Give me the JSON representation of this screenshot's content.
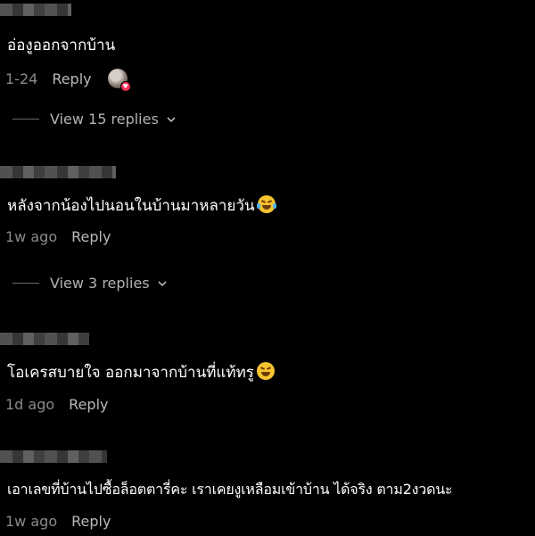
{
  "comments": [
    {
      "text": "อ่องูออกจากบ้าน",
      "emoji": "",
      "time": "1-24",
      "reply_label": "Reply",
      "view_replies": "View 15 replies"
    },
    {
      "text": "หลังจากน้องไปนอนในบ้านมาหลายวัน",
      "emoji": "tears-of-joy-emoji",
      "time": "1w ago",
      "reply_label": "Reply",
      "view_replies": "View 3 replies"
    },
    {
      "text": "โอเครสบายใจ ออกมาจากบ้านที่แท้ทรู",
      "emoji": "laughing-emoji",
      "time": "1d ago",
      "reply_label": "Reply"
    },
    {
      "text": "เอาเลขที่บ้านไปซื้อล็อตตารี่คะ เราเคยงูเหลือมเข้าบ้าน ได้จริง ตาม2งวดนะ",
      "emoji": "",
      "time": "1w ago",
      "reply_label": "Reply"
    }
  ],
  "icons": {
    "liker_avatar": "creator-avatar-icon",
    "liked_heart": "heart-badge-icon",
    "expand": "chevron-down-icon"
  },
  "colors": {
    "background": "#000000",
    "text": "#ffffff",
    "muted": "#8a8a8a",
    "heart": "#fe2c55"
  }
}
